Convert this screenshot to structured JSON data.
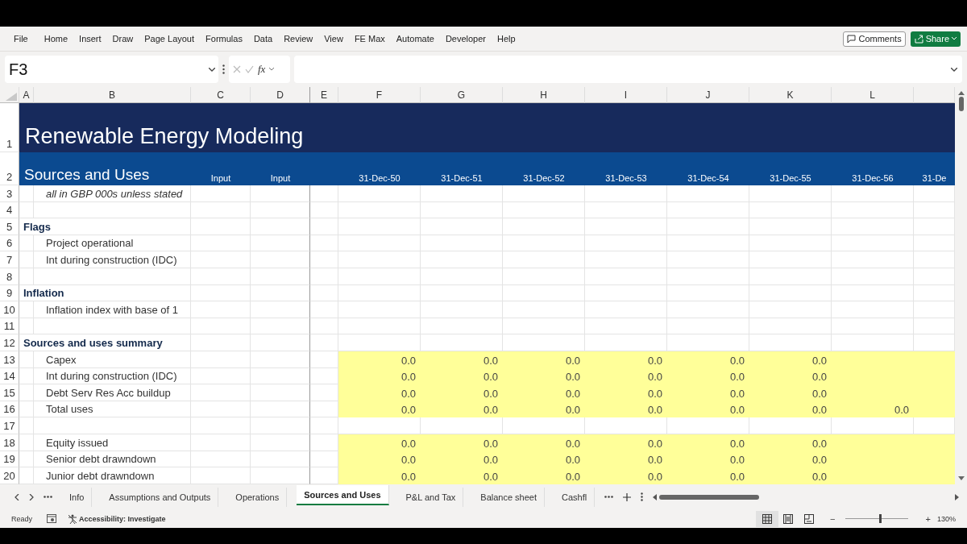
{
  "menu": {
    "items": [
      "File",
      "Home",
      "Insert",
      "Draw",
      "Page Layout",
      "Formulas",
      "Data",
      "Review",
      "View",
      "FE Max",
      "Automate",
      "Developer",
      "Help"
    ],
    "comments_button": "Comments",
    "share_button": "Share"
  },
  "formula_bar": {
    "name_box": "F3",
    "function_label": "fx"
  },
  "columns": [
    "A",
    "B",
    "C",
    "D",
    "E",
    "F",
    "G",
    "H",
    "I",
    "J",
    "K",
    "L"
  ],
  "rows": [
    {
      "num": "1",
      "kind": "title",
      "text": "Renewable Energy Modeling"
    },
    {
      "num": "2",
      "kind": "subtitle",
      "text": "Sources and Uses",
      "inputs": [
        "Input",
        "Input"
      ],
      "dates": [
        "31-Dec-50",
        "31-Dec-51",
        "31-Dec-52",
        "31-Dec-53",
        "31-Dec-54",
        "31-Dec-55",
        "31-Dec-56",
        "31-De"
      ]
    },
    {
      "num": "3",
      "kind": "note",
      "text": "all in GBP 000s unless stated"
    },
    {
      "num": "4",
      "kind": "blank"
    },
    {
      "num": "5",
      "kind": "section",
      "text": "Flags"
    },
    {
      "num": "6",
      "kind": "item",
      "text": "Project operational",
      "highlighted": false
    },
    {
      "num": "7",
      "kind": "item",
      "text": "Int during construction (IDC)",
      "highlighted": false
    },
    {
      "num": "8",
      "kind": "blank"
    },
    {
      "num": "9",
      "kind": "section",
      "text": "Inflation"
    },
    {
      "num": "10",
      "kind": "item",
      "text": "Inflation index with base of 1",
      "highlighted": false
    },
    {
      "num": "11",
      "kind": "blank"
    },
    {
      "num": "12",
      "kind": "section",
      "text": "Sources and uses summary"
    },
    {
      "num": "13",
      "kind": "item",
      "text": "Capex",
      "highlighted": true,
      "values": [
        "0.0",
        "0.0",
        "0.0",
        "0.0",
        "0.0",
        "0.0"
      ]
    },
    {
      "num": "14",
      "kind": "item",
      "text": "Int during construction (IDC)",
      "highlighted": true,
      "values": [
        "0.0",
        "0.0",
        "0.0",
        "0.0",
        "0.0",
        "0.0"
      ]
    },
    {
      "num": "15",
      "kind": "item",
      "text": "Debt Serv Res Acc buildup",
      "highlighted": true,
      "values": [
        "0.0",
        "0.0",
        "0.0",
        "0.0",
        "0.0",
        "0.0"
      ]
    },
    {
      "num": "16",
      "kind": "item",
      "text": "Total uses",
      "highlighted": true,
      "values": [
        "0.0",
        "0.0",
        "0.0",
        "0.0",
        "0.0",
        "0.0",
        "0.0"
      ]
    },
    {
      "num": "17",
      "kind": "blank"
    },
    {
      "num": "18",
      "kind": "item",
      "text": "Equity issued",
      "highlighted": true,
      "values": [
        "0.0",
        "0.0",
        "0.0",
        "0.0",
        "0.0",
        "0.0"
      ]
    },
    {
      "num": "19",
      "kind": "item",
      "text": "Senior debt drawndown",
      "highlighted": true,
      "values": [
        "0.0",
        "0.0",
        "0.0",
        "0.0",
        "0.0",
        "0.0"
      ]
    },
    {
      "num": "20",
      "kind": "item",
      "text": "Junior debt drawndown",
      "highlighted": true,
      "values": [
        "0.0",
        "0.0",
        "0.0",
        "0.0",
        "0.0",
        "0.0"
      ]
    }
  ],
  "sheet_tabs": [
    {
      "label": "Info",
      "selected": false
    },
    {
      "label": "Assumptions and Outputs",
      "selected": false
    },
    {
      "label": "Operations",
      "selected": false
    },
    {
      "label": "Sources and Uses",
      "selected": true
    },
    {
      "label": "P&L and Tax",
      "selected": false
    },
    {
      "label": "Balance sheet",
      "selected": false
    },
    {
      "label": "Cashfl",
      "selected": false
    }
  ],
  "status_bar": {
    "status": "Ready",
    "accessibility": "Accessibility: Investigate",
    "views": [
      {
        "kind": "normal",
        "selected": true
      },
      {
        "kind": "page_layout",
        "selected": false
      },
      {
        "kind": "page_break",
        "selected": false
      }
    ],
    "zoom": {
      "zoom_out": "−",
      "level": 0.55,
      "zoom_in": "+",
      "reading": "130%"
    }
  }
}
